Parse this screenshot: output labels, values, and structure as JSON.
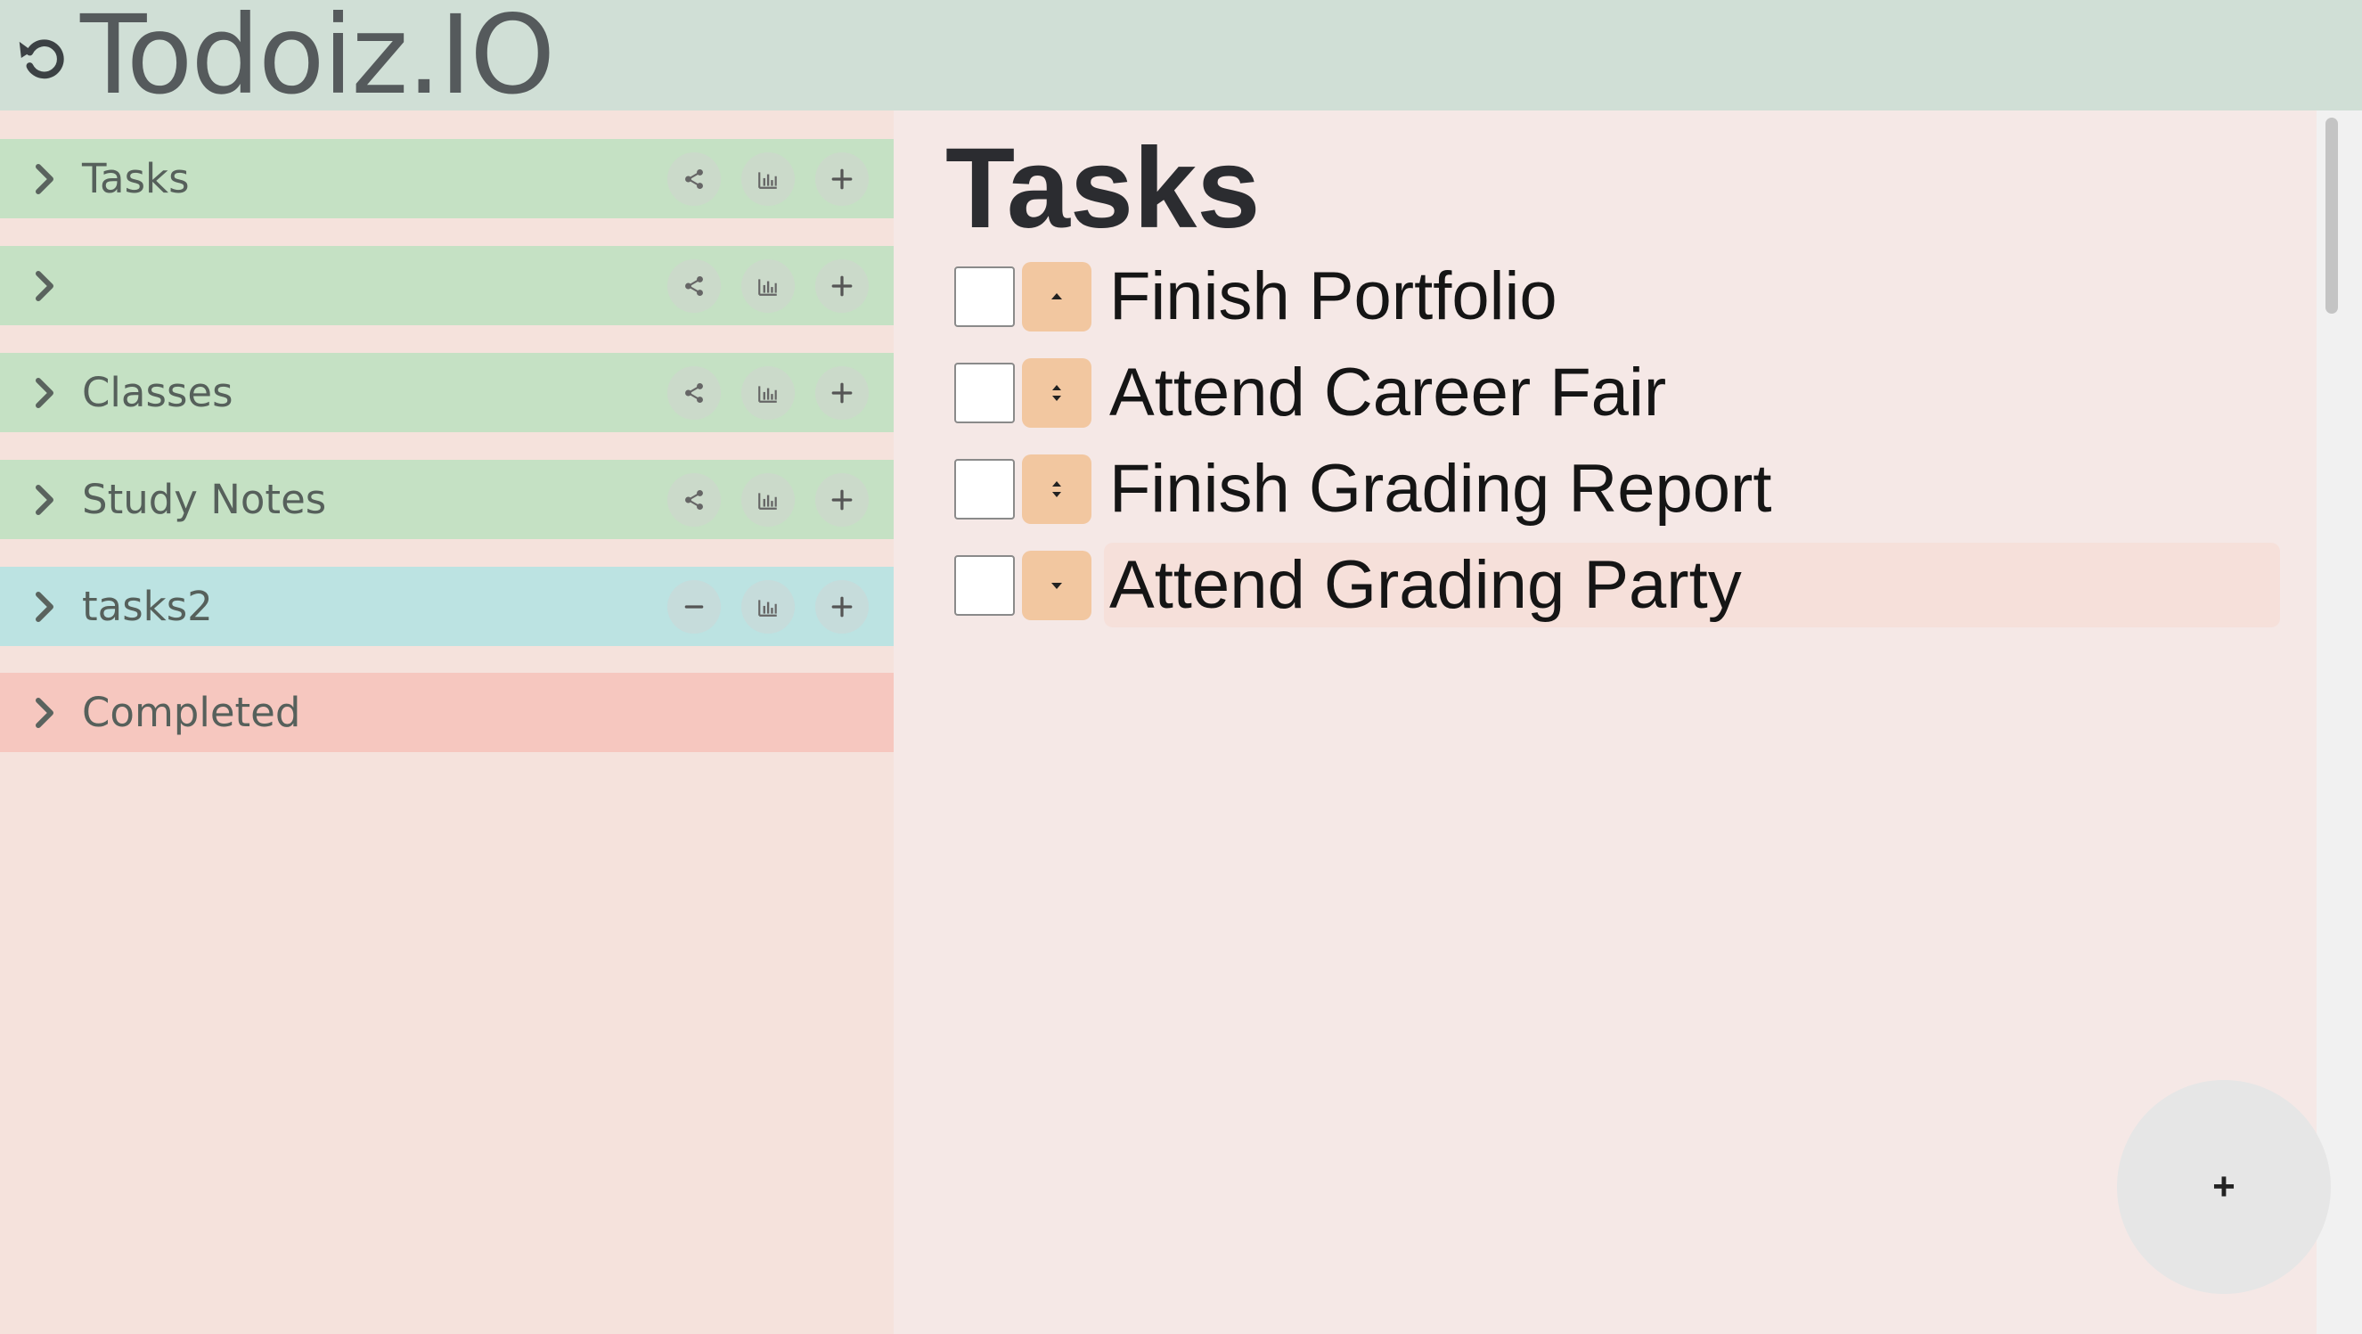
{
  "app": {
    "title": "Todoiz.IO",
    "undo_icon": "undo-icon"
  },
  "sidebar": {
    "lists": [
      {
        "label": "Tasks",
        "color": "#c5e1c4",
        "share": "share-icon",
        "stats": "chart-icon",
        "add": "plus-icon"
      },
      {
        "label": "",
        "color": "#c5e1c4",
        "share": "share-icon",
        "stats": "chart-icon",
        "add": "plus-icon"
      },
      {
        "label": "Classes",
        "color": "#c5e1c4",
        "share": "share-icon",
        "stats": "chart-icon",
        "add": "plus-icon"
      },
      {
        "label": "Study Notes",
        "color": "#c5e1c4",
        "share": "share-icon",
        "stats": "chart-icon",
        "add": "plus-icon"
      },
      {
        "label": "tasks2",
        "color": "#bce3e2",
        "share": "minus-icon",
        "stats": "chart-icon",
        "add": "plus-icon"
      },
      {
        "label": "Completed",
        "color": "#f6c7bf"
      }
    ]
  },
  "main": {
    "title": "Tasks",
    "tasks": [
      {
        "text": "Finish Portfolio",
        "priority_control": "arrow-up"
      },
      {
        "text": "Attend Career Fair",
        "priority_control": "arrows-up-down"
      },
      {
        "text": "Finish Grading Report",
        "priority_control": "arrows-up-down"
      },
      {
        "text": "Attend Grading Party",
        "priority_control": "arrow-down"
      }
    ],
    "add_button_label": "+"
  },
  "colors": {
    "header": "#d0dfd6",
    "sidebar_bg": "#f5e2dc",
    "main_bg": "#f5e8e6",
    "priority_button": "#f2c7a0"
  }
}
